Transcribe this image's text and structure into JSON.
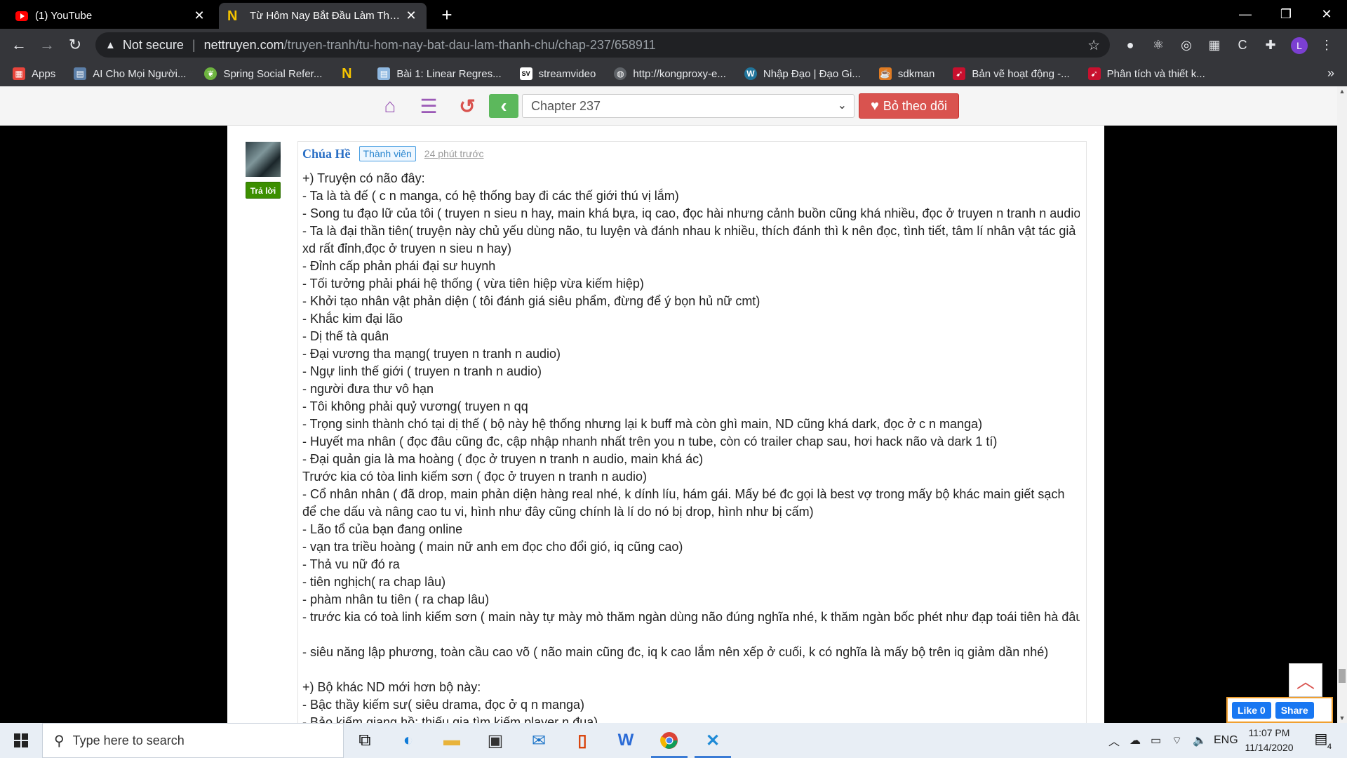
{
  "browser": {
    "tabs": [
      {
        "title": "(1) YouTube",
        "icon": "youtube-icon"
      },
      {
        "title": "Từ Hôm Nay Bắt Đầu Làm Thành",
        "icon": "nettruyen-icon"
      }
    ],
    "address": {
      "security": "Not secure",
      "host": "nettruyen.com",
      "path": "/truyen-tranh/tu-hom-nay-bat-dau-lam-thanh-chu/chap-237/658911"
    },
    "profile_initial": "L",
    "bookmarks": [
      {
        "label": "Apps",
        "icon": "apps-grid-icon",
        "color": "#e8453c"
      },
      {
        "label": "AI Cho Mọi Người...",
        "icon": "ai-book-icon",
        "color": "#5c7fa8"
      },
      {
        "label": "Spring Social Refer...",
        "icon": "spring-leaf-icon",
        "color": "#6db33f"
      },
      {
        "label": "",
        "icon": "nettruyen-icon",
        "color": "#f5c400"
      },
      {
        "label": "Bài 1: Linear Regres...",
        "icon": "doc-icon",
        "color": "#8fb8e0"
      },
      {
        "label": "streamvideo",
        "icon": "stream-icon",
        "color": "#222222"
      },
      {
        "label": "http://kongproxy-e...",
        "icon": "globe-icon",
        "color": "#5f6368"
      },
      {
        "label": "Nhập Đạo | Đạo Gi...",
        "icon": "wordpress-icon",
        "color": "#21759b"
      },
      {
        "label": "sdkman",
        "icon": "sdkman-icon",
        "color": "#e07b22"
      },
      {
        "label": "Bản vẽ hoạt động -...",
        "icon": "bird-icon",
        "color": "#c8102e"
      },
      {
        "label": "Phân tích và thiết k...",
        "icon": "bird-icon",
        "color": "#c8102e"
      }
    ]
  },
  "reader": {
    "chapter": "Chapter 237",
    "follow_label": "Bỏ theo dõi",
    "colors": {
      "icons": "#9b59b6",
      "history": "#d9534f",
      "back": "#5cb85c",
      "follow": "#d9534f"
    }
  },
  "comment": {
    "author": "Chúa Hề",
    "role": "Thành viên",
    "time": "24 phút trước",
    "reply_label": "Trả lời",
    "lines": [
      "+) Truyện có não đây:",
      "- Ta là tà đế ( c n manga, có hệ thống bay đi các thế giới thú vị lắm)",
      "- Song tu đạo lữ của tôi ( truyen n sieu n hay, main khá bựa, iq cao, đọc hài nhưng cảnh buồn cũng khá nhiều, đọc ở truyen n tranh n audio)",
      "- Ta là đại thần tiên( truyện này chủ yếu dùng não, tu luyện và đánh nhau k nhiều, thích đánh thì k nên đọc, tình tiết, tâm lí nhân vật tác giả xd rất đỉnh,đọc ở truyen n sieu n hay)",
      "- Đỉnh cấp phản phái đại sư huynh",
      "- Tối tưởng phải phái hệ thống ( vừa tiên hiệp vừa kiếm hiệp)",
      "- Khởi tạo nhân vật phản diện ( tôi đánh giá siêu phẩm, đừng để ý bọn hủ nữ cmt)",
      "- Khắc kim đại lão",
      "- Dị thế tà quân",
      "- Đại vương tha mạng( truyen n tranh n audio)",
      "- Ngự linh thế giới ( truyen n tranh n audio)",
      "- người đưa thư vô hạn",
      "- Tôi không phải quỷ vương( truyen n qq",
      "- Trọng sinh thành chó tại dị thế ( bộ này hệ thống nhưng lại k buff mà còn ghì main, ND cũng khá dark, đọc ở c n manga)",
      "- Huyết ma nhân ( đọc đâu cũng đc, cập nhập nhanh nhất trên you n tube, còn có trailer chap sau, hơi hack não và dark 1 tí)",
      "- Đại quản gia là ma hoàng ( đọc ở truyen n tranh n audio, main khá ác)",
      "Trước kia có tòa linh kiếm sơn ( đọc ở truyen n tranh n audio)",
      "- Cổ nhân nhân ( đã drop, main phản diện hàng real nhé, k dính líu, hám gái. Mấy bé đc gọi là best vợ trong mấy bộ khác main giết sạch để che dấu và nâng cao tu vi, hình như đây cũng chính là lí do nó bị drop, hình như bị cấm)",
      "- Lão tổ của bạn đang online",
      "- vạn tra triều hoàng ( main nữ anh em đọc cho đổi gió, iq cũng cao)",
      "- Thả vu nữ đó ra",
      "- tiên nghịch( ra chap lâu)",
      "- phàm nhân tu tiên ( ra chap lâu)",
      "- trước kia có toà linh kiếm sơn ( main này tự mày mò thăm ngàn dùng não đúng nghĩa nhé, k thăm ngàn bốc phét như đạp toái tiên hà đâu)",
      "",
      "- siêu năng lập phương, toàn cầu cao võ ( não main cũng đc, iq k cao lắm nên xếp ở cuối, k có nghĩa là mấy bộ trên iq giảm dần nhé)",
      "",
      "+) Bộ khác ND mới hơn bộ này:",
      "- Bậc thầy kiếm sư( siêu drama, đọc ở q n manga)",
      "- Bảo kiếm giang hồ: thiếu gia tìm kiếm player n đua)"
    ]
  },
  "facebook": {
    "like": "Like 0",
    "share": "Share"
  },
  "taskbar": {
    "search_placeholder": "Type here to search",
    "language": "ENG",
    "time": "11:07 PM",
    "date": "11/14/2020",
    "notifications": "4"
  }
}
